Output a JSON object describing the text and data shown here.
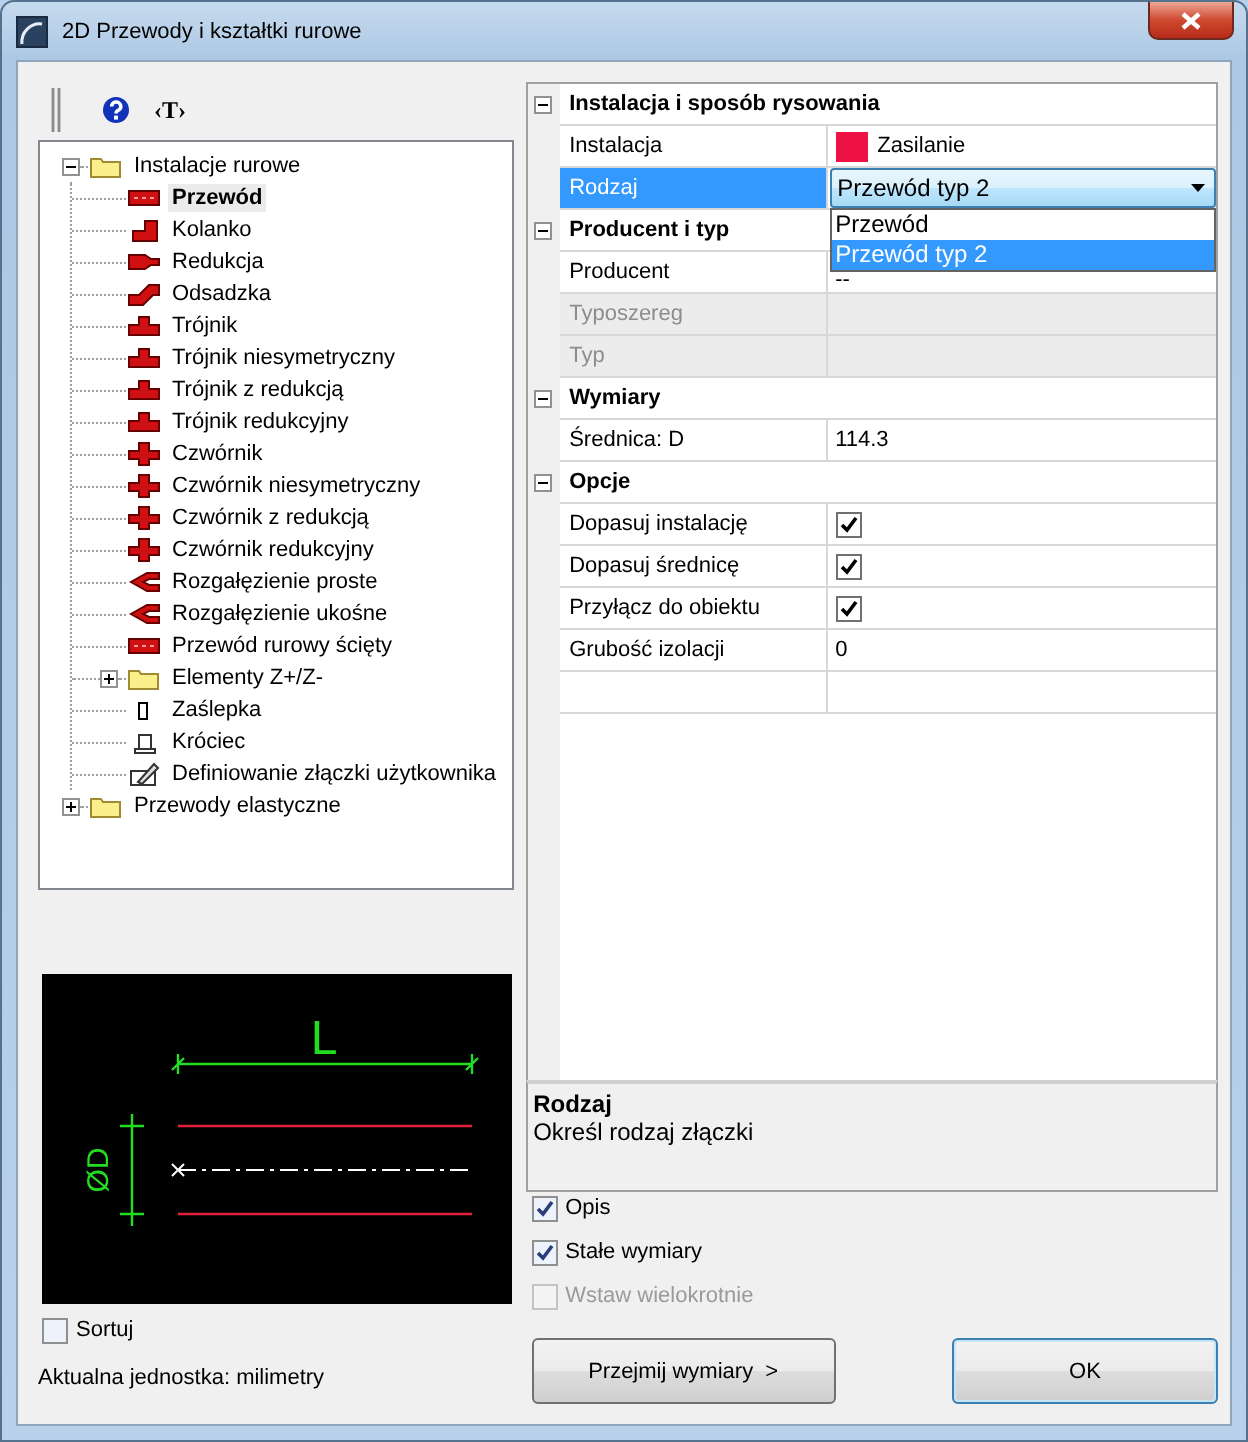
{
  "window": {
    "title": "2D Przewody i kształtki rurowe"
  },
  "toolbar": {
    "text_button": "‹T›"
  },
  "tree": [
    {
      "label": "Instalacje rurowe",
      "kind": "folder",
      "expanded": true,
      "selected": false,
      "children": [
        {
          "label": "Przewód",
          "kind": "pipe",
          "selected": true
        },
        {
          "label": "Kolanko",
          "kind": "elbow",
          "selected": false
        },
        {
          "label": "Redukcja",
          "kind": "reducer",
          "selected": false
        },
        {
          "label": "Odsadzka",
          "kind": "offset",
          "selected": false
        },
        {
          "label": "Trójnik",
          "kind": "tee",
          "selected": false
        },
        {
          "label": "Trójnik niesymetryczny",
          "kind": "tee",
          "selected": false
        },
        {
          "label": "Trójnik z redukcją",
          "kind": "tee",
          "selected": false
        },
        {
          "label": "Trójnik redukcyjny",
          "kind": "tee",
          "selected": false
        },
        {
          "label": "Czwórnik",
          "kind": "cross",
          "selected": false
        },
        {
          "label": "Czwórnik niesymetryczny",
          "kind": "cross",
          "selected": false
        },
        {
          "label": "Czwórnik z redukcją",
          "kind": "cross",
          "selected": false
        },
        {
          "label": "Czwórnik redukcyjny",
          "kind": "cross",
          "selected": false
        },
        {
          "label": "Rozgałęzienie proste",
          "kind": "branch",
          "selected": false
        },
        {
          "label": "Rozgałęzienie ukośne",
          "kind": "branch",
          "selected": false
        },
        {
          "label": "Przewód rurowy ścięty",
          "kind": "pipe",
          "selected": false
        },
        {
          "label": "Elementy Z+/Z-",
          "kind": "folder",
          "expanded": false,
          "selected": false
        },
        {
          "label": "Zaślepka",
          "kind": "cap",
          "selected": false
        },
        {
          "label": "Króciec",
          "kind": "stub",
          "selected": false
        },
        {
          "label": "Definiowanie złączki użytkownika",
          "kind": "custom",
          "selected": false
        }
      ]
    },
    {
      "label": "Przewody elastyczne",
      "kind": "folder",
      "expanded": false,
      "selected": false
    }
  ],
  "preview": {
    "length_label": "L",
    "diameter_label": "ØD"
  },
  "sort": {
    "label": "Sortuj",
    "checked": false
  },
  "unit_text": "Aktualna jednostka: milimetry",
  "properties": {
    "sections": [
      {
        "title": "Instalacja i sposób rysowania",
        "expanded": true,
        "rows": [
          {
            "kind": "color",
            "name": "Instalacja",
            "value": "Zasilanie",
            "color": "#ee1144",
            "selected": false,
            "disabled": false
          },
          {
            "kind": "dropdown",
            "name": "Rodzaj",
            "value": "Przewód typ 2",
            "selected": true,
            "disabled": false,
            "open": true,
            "options": [
              {
                "label": "Przewód",
                "selected": false
              },
              {
                "label": "Przewód typ 2",
                "selected": true
              }
            ]
          }
        ]
      },
      {
        "title": "Producent i typ",
        "expanded": true,
        "rows": [
          {
            "kind": "text",
            "name": "Producent",
            "value": "--",
            "selected": false,
            "disabled": false
          },
          {
            "kind": "text",
            "name": "Typoszereg",
            "selected": false,
            "disabled": true
          },
          {
            "kind": "text",
            "name": "Typ",
            "selected": false,
            "disabled": true
          }
        ]
      },
      {
        "title": "Wymiary",
        "expanded": true,
        "rows": [
          {
            "kind": "text",
            "name": "Średnica: D",
            "value": "114.3",
            "selected": false,
            "disabled": false
          }
        ]
      },
      {
        "title": "Opcje",
        "expanded": true,
        "rows": [
          {
            "kind": "checkbox",
            "name": "Dopasuj instalację",
            "checked": true,
            "selected": false,
            "disabled": false
          },
          {
            "kind": "checkbox",
            "name": "Dopasuj średnicę",
            "checked": true,
            "selected": false,
            "disabled": false
          },
          {
            "kind": "checkbox",
            "name": "Przyłącz do obiektu",
            "checked": true,
            "selected": false,
            "disabled": false
          },
          {
            "kind": "text",
            "name": "Grubość izolacji",
            "value": "0",
            "selected": false,
            "disabled": false
          },
          {
            "kind": "blank"
          }
        ]
      }
    ]
  },
  "description": {
    "title": "Rodzaj",
    "text": "Określ rodzaj złączki"
  },
  "options": [
    {
      "label": "Opis",
      "checked": true,
      "disabled": false
    },
    {
      "label": "Stałe wymiary",
      "checked": true,
      "disabled": false
    },
    {
      "label": "Wstaw wielokrotnie",
      "checked": false,
      "disabled": true
    }
  ],
  "buttons": [
    {
      "label": "Przejmij wymiary  >",
      "kind": "normal"
    },
    {
      "label": "OK",
      "kind": "default"
    }
  ]
}
